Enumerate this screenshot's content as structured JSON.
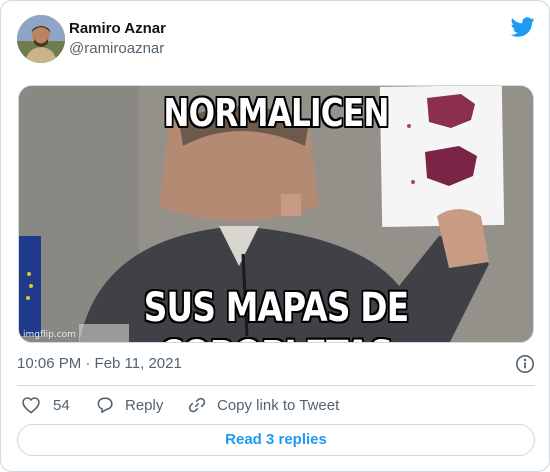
{
  "tweet": {
    "author": {
      "display_name": "Ramiro Aznar",
      "handle": "@ramiroaznar"
    },
    "media": {
      "top_text": "NORMALICEN",
      "bottom_text": "SUS MAPAS DE COROPLETAS",
      "watermark": "imgflip.com"
    },
    "timestamp": "10:06 PM · Feb 11, 2021",
    "actions": {
      "like_count": "54",
      "reply_label": "Reply",
      "copy_link_label": "Copy link to Tweet"
    },
    "read_replies_label": "Read 3 replies"
  },
  "icons": {
    "brand": "twitter-bird-icon",
    "info": "info-icon",
    "like": "heart-icon",
    "reply": "speech-bubble-icon",
    "copy": "link-icon"
  },
  "colors": {
    "brand_blue": "#1d9bf0",
    "secondary_text": "#536471",
    "border": "#cfd9de"
  }
}
